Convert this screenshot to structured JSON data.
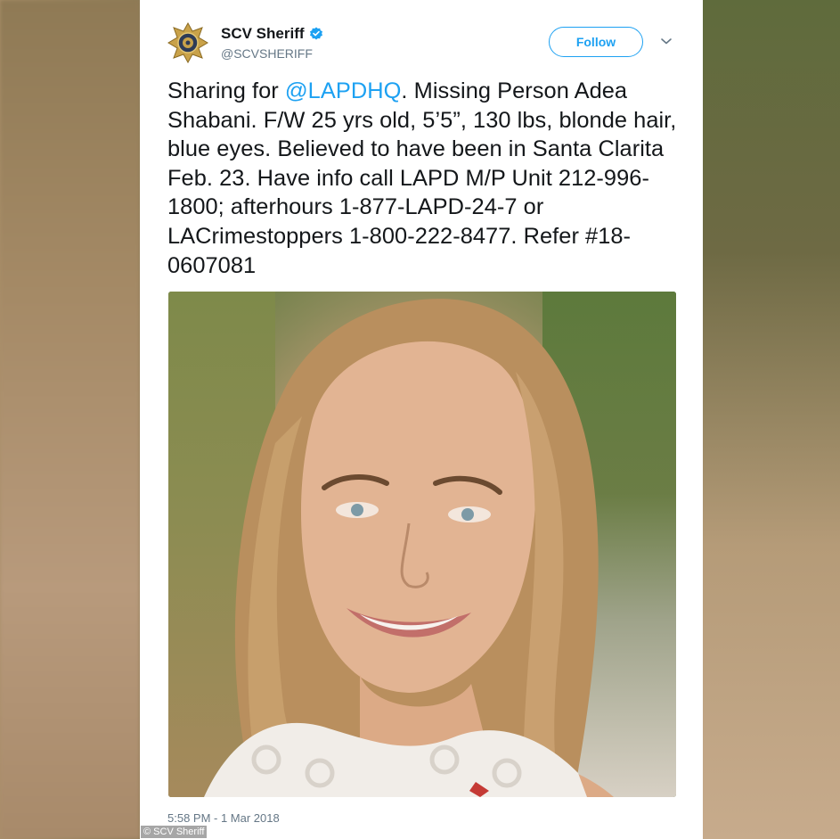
{
  "tweet": {
    "display_name": "SCV Sheriff",
    "handle": "@SCVSHERIFF",
    "follow_label": "Follow",
    "text_prefix": "Sharing for ",
    "mention": "@LAPDHQ",
    "text_suffix": ". Missing Person Adea Shabani. F/W 25 yrs old, 5’5”, 130 lbs, blonde hair, blue eyes. Believed to have been in Santa Clarita Feb. 23. Have info call LAPD M/P Unit 212-996-1800; afterhours 1-877-LAPD-24-7 or LACrimestoppers 1-800-222-8477. Refer #18-0607081",
    "timestamp": "5:58 PM - 1 Mar 2018"
  },
  "watermark": "© SCV Sheriff",
  "icons": {
    "avatar": "sheriff-star-badge-icon",
    "verified": "verified-badge-icon",
    "menu": "chevron-down-icon"
  },
  "colors": {
    "accent": "#1da1f2",
    "text": "#14171a",
    "secondary_text": "#657786",
    "badge_gold": "#c9a24a"
  }
}
